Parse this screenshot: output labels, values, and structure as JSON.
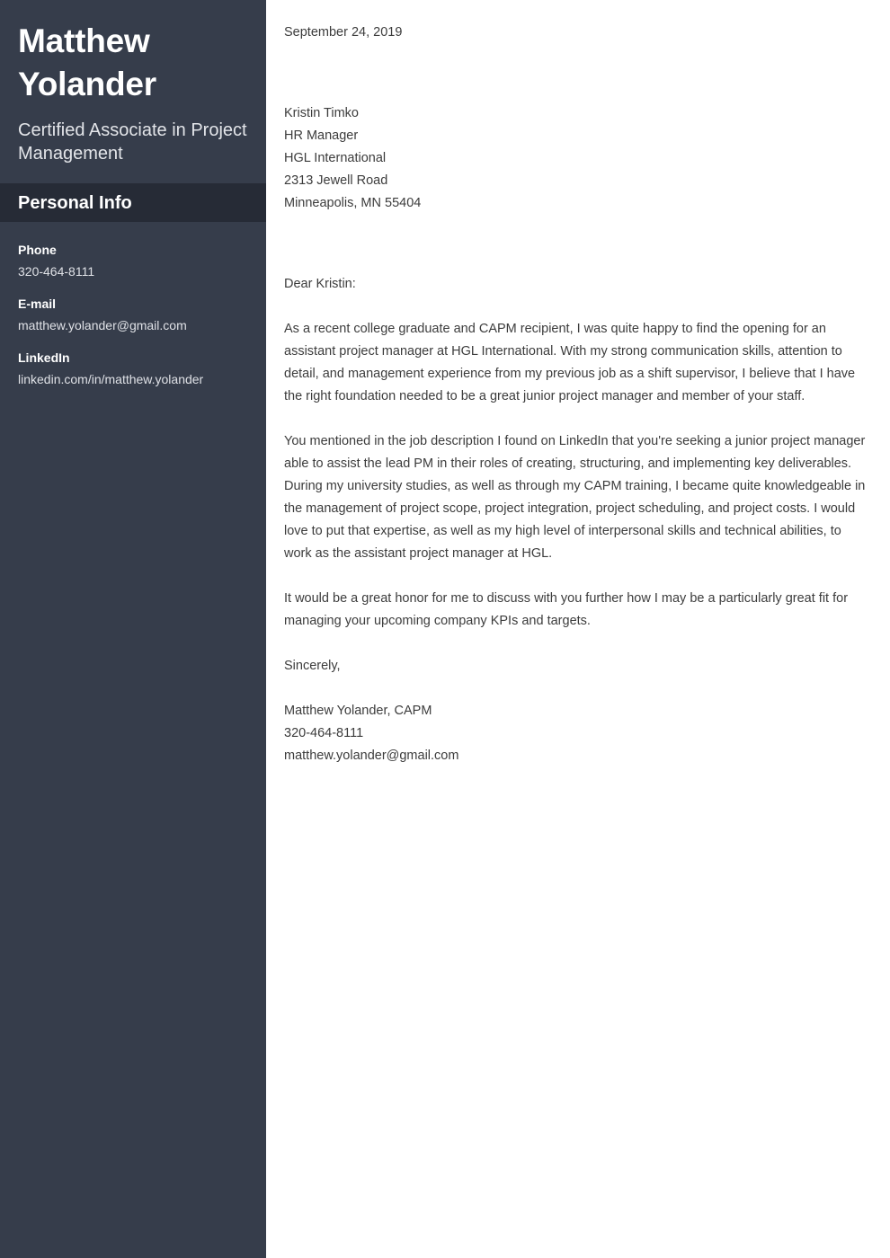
{
  "sidebar": {
    "name": "Matthew Yolander",
    "title": "Certified Associate in Project Management",
    "section_title": "Personal Info",
    "contacts": [
      {
        "label": "Phone",
        "value": "320-464-8111"
      },
      {
        "label": "E-mail",
        "value": "matthew.yolander@gmail.com"
      },
      {
        "label": "LinkedIn",
        "value": "linkedin.com/in/matthew.yolander"
      }
    ],
    "bg_color": "#363d4b",
    "band_color": "#262b36"
  },
  "letter": {
    "date": "September 24, 2019",
    "recipient": [
      "Kristin Timko",
      "HR Manager",
      "HGL International",
      "2313 Jewell Road",
      "Minneapolis, MN 55404"
    ],
    "salutation": "Dear Kristin:",
    "paragraphs": [
      "As a recent college graduate and CAPM recipient, I was quite happy to find the opening for an assistant project manager at HGL International. With my strong communication skills, attention to detail, and management experience from my previous job as a shift supervisor, I believe that I have the right foundation needed to be a great junior project manager and member of your staff.",
      "You mentioned in the job description I found on LinkedIn that you're seeking a junior project manager able to assist the lead PM in their roles of creating, structuring, and implementing key deliverables. During my university studies, as well as through my CAPM training, I became quite knowledgeable in the management of project scope, project integration, project scheduling, and project costs. I would love to put that expertise, as well as my high level of interpersonal skills and technical abilities, to work as the assistant project manager at HGL.",
      "It would be a great honor for me to discuss with you further how I may be a particularly great fit for managing your upcoming company KPIs and targets."
    ],
    "closing": "Sincerely,",
    "signature": [
      "Matthew Yolander, CAPM",
      "320-464-8111",
      "matthew.yolander@gmail.com"
    ],
    "text_color": "#3c3c3c"
  }
}
